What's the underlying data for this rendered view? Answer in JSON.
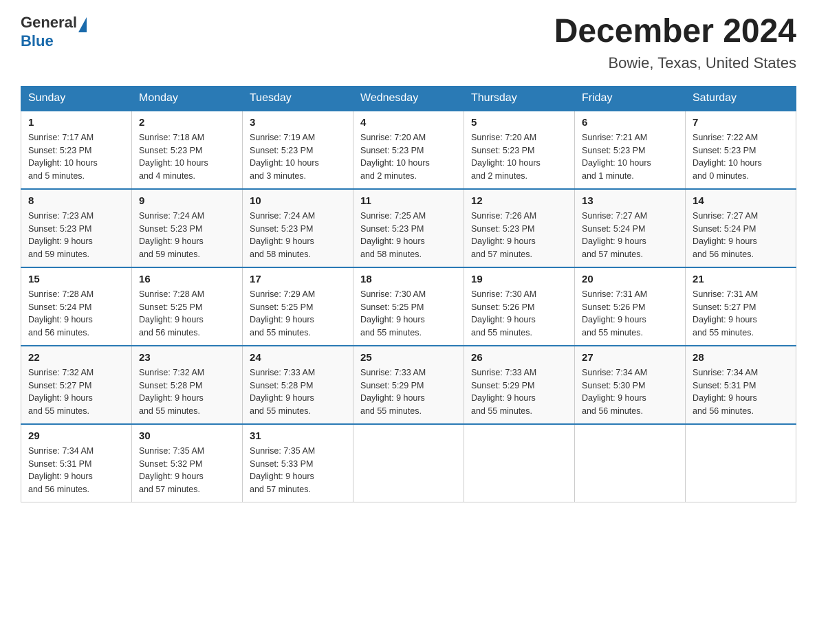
{
  "header": {
    "logo_general": "General",
    "logo_blue": "Blue",
    "month_title": "December 2024",
    "location": "Bowie, Texas, United States"
  },
  "days_of_week": [
    "Sunday",
    "Monday",
    "Tuesday",
    "Wednesday",
    "Thursday",
    "Friday",
    "Saturday"
  ],
  "weeks": [
    [
      {
        "day": "1",
        "sunrise": "7:17 AM",
        "sunset": "5:23 PM",
        "daylight": "10 hours and 5 minutes."
      },
      {
        "day": "2",
        "sunrise": "7:18 AM",
        "sunset": "5:23 PM",
        "daylight": "10 hours and 4 minutes."
      },
      {
        "day": "3",
        "sunrise": "7:19 AM",
        "sunset": "5:23 PM",
        "daylight": "10 hours and 3 minutes."
      },
      {
        "day": "4",
        "sunrise": "7:20 AM",
        "sunset": "5:23 PM",
        "daylight": "10 hours and 2 minutes."
      },
      {
        "day": "5",
        "sunrise": "7:20 AM",
        "sunset": "5:23 PM",
        "daylight": "10 hours and 2 minutes."
      },
      {
        "day": "6",
        "sunrise": "7:21 AM",
        "sunset": "5:23 PM",
        "daylight": "10 hours and 1 minute."
      },
      {
        "day": "7",
        "sunrise": "7:22 AM",
        "sunset": "5:23 PM",
        "daylight": "10 hours and 0 minutes."
      }
    ],
    [
      {
        "day": "8",
        "sunrise": "7:23 AM",
        "sunset": "5:23 PM",
        "daylight": "9 hours and 59 minutes."
      },
      {
        "day": "9",
        "sunrise": "7:24 AM",
        "sunset": "5:23 PM",
        "daylight": "9 hours and 59 minutes."
      },
      {
        "day": "10",
        "sunrise": "7:24 AM",
        "sunset": "5:23 PM",
        "daylight": "9 hours and 58 minutes."
      },
      {
        "day": "11",
        "sunrise": "7:25 AM",
        "sunset": "5:23 PM",
        "daylight": "9 hours and 58 minutes."
      },
      {
        "day": "12",
        "sunrise": "7:26 AM",
        "sunset": "5:23 PM",
        "daylight": "9 hours and 57 minutes."
      },
      {
        "day": "13",
        "sunrise": "7:27 AM",
        "sunset": "5:24 PM",
        "daylight": "9 hours and 57 minutes."
      },
      {
        "day": "14",
        "sunrise": "7:27 AM",
        "sunset": "5:24 PM",
        "daylight": "9 hours and 56 minutes."
      }
    ],
    [
      {
        "day": "15",
        "sunrise": "7:28 AM",
        "sunset": "5:24 PM",
        "daylight": "9 hours and 56 minutes."
      },
      {
        "day": "16",
        "sunrise": "7:28 AM",
        "sunset": "5:25 PM",
        "daylight": "9 hours and 56 minutes."
      },
      {
        "day": "17",
        "sunrise": "7:29 AM",
        "sunset": "5:25 PM",
        "daylight": "9 hours and 55 minutes."
      },
      {
        "day": "18",
        "sunrise": "7:30 AM",
        "sunset": "5:25 PM",
        "daylight": "9 hours and 55 minutes."
      },
      {
        "day": "19",
        "sunrise": "7:30 AM",
        "sunset": "5:26 PM",
        "daylight": "9 hours and 55 minutes."
      },
      {
        "day": "20",
        "sunrise": "7:31 AM",
        "sunset": "5:26 PM",
        "daylight": "9 hours and 55 minutes."
      },
      {
        "day": "21",
        "sunrise": "7:31 AM",
        "sunset": "5:27 PM",
        "daylight": "9 hours and 55 minutes."
      }
    ],
    [
      {
        "day": "22",
        "sunrise": "7:32 AM",
        "sunset": "5:27 PM",
        "daylight": "9 hours and 55 minutes."
      },
      {
        "day": "23",
        "sunrise": "7:32 AM",
        "sunset": "5:28 PM",
        "daylight": "9 hours and 55 minutes."
      },
      {
        "day": "24",
        "sunrise": "7:33 AM",
        "sunset": "5:28 PM",
        "daylight": "9 hours and 55 minutes."
      },
      {
        "day": "25",
        "sunrise": "7:33 AM",
        "sunset": "5:29 PM",
        "daylight": "9 hours and 55 minutes."
      },
      {
        "day": "26",
        "sunrise": "7:33 AM",
        "sunset": "5:29 PM",
        "daylight": "9 hours and 55 minutes."
      },
      {
        "day": "27",
        "sunrise": "7:34 AM",
        "sunset": "5:30 PM",
        "daylight": "9 hours and 56 minutes."
      },
      {
        "day": "28",
        "sunrise": "7:34 AM",
        "sunset": "5:31 PM",
        "daylight": "9 hours and 56 minutes."
      }
    ],
    [
      {
        "day": "29",
        "sunrise": "7:34 AM",
        "sunset": "5:31 PM",
        "daylight": "9 hours and 56 minutes."
      },
      {
        "day": "30",
        "sunrise": "7:35 AM",
        "sunset": "5:32 PM",
        "daylight": "9 hours and 57 minutes."
      },
      {
        "day": "31",
        "sunrise": "7:35 AM",
        "sunset": "5:33 PM",
        "daylight": "9 hours and 57 minutes."
      },
      null,
      null,
      null,
      null
    ]
  ],
  "labels": {
    "sunrise": "Sunrise:",
    "sunset": "Sunset:",
    "daylight": "Daylight:"
  }
}
